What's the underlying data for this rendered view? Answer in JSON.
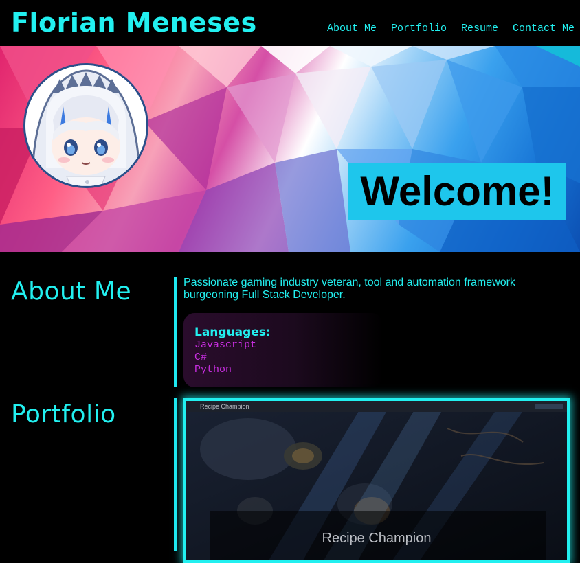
{
  "header": {
    "site_title": "Florian Meneses",
    "nav": [
      "About Me",
      "Portfolio",
      "Resume",
      "Contact Me"
    ]
  },
  "hero": {
    "welcome": "Welcome!"
  },
  "about": {
    "heading": "About Me",
    "text": "Passionate gaming industry veteran, tool and automation framework burgeoning Full Stack Developer.",
    "languages_title": "Languages:",
    "languages": [
      "Javascript",
      "C#",
      "Python"
    ]
  },
  "portfolio": {
    "heading": "Portfolio",
    "project": {
      "app_bar_title": "Recipe Champion",
      "caption": "Recipe Champion"
    }
  },
  "colors": {
    "accent": "#22f0f0",
    "language_text": "#c82ee0",
    "welcome_bg": "#1ec6ec",
    "background": "#000000"
  }
}
